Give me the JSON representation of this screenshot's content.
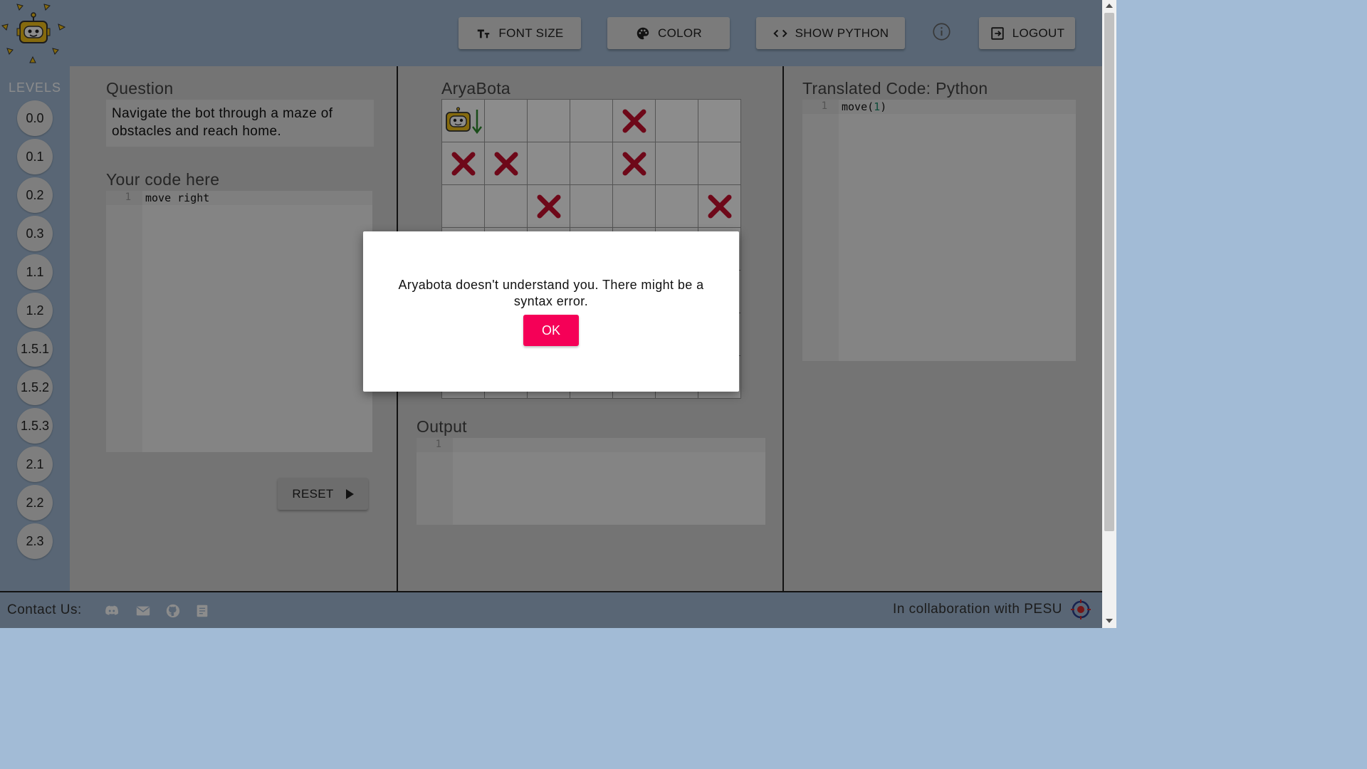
{
  "header": {
    "buttons": [
      {
        "id": "font-size",
        "label": "FONT SIZE",
        "icon": "font-size-icon"
      },
      {
        "id": "color",
        "label": "COLOR",
        "icon": "palette-icon"
      },
      {
        "id": "show-python",
        "label": "SHOW PYTHON",
        "icon": "code-icon"
      },
      {
        "id": "logout",
        "label": "LOGOUT",
        "icon": "logout-icon"
      }
    ],
    "info_icon": "info-icon"
  },
  "sidebar": {
    "title": "LEVELS",
    "levels": [
      "0.0",
      "0.1",
      "0.2",
      "0.3",
      "1.1",
      "1.2",
      "1.5.1",
      "1.5.2",
      "1.5.3",
      "2.1",
      "2.2",
      "2.3"
    ]
  },
  "question": {
    "title": "Question",
    "text": "Navigate the bot through a maze of obstacles and reach home."
  },
  "code_editor": {
    "title": "Your code here",
    "line_number": "1",
    "code": "move right"
  },
  "reset_button": {
    "label": "RESET"
  },
  "maze": {
    "title": "AryaBota",
    "rows": 7,
    "cols": 7,
    "bot": {
      "row": 0,
      "col": 0,
      "facing": "down"
    },
    "obstacles": [
      [
        0,
        4
      ],
      [
        1,
        0
      ],
      [
        1,
        1
      ],
      [
        1,
        4
      ],
      [
        2,
        2
      ],
      [
        2,
        6
      ]
    ],
    "colors": {
      "obstacle": "#c8102e",
      "arrow": "#2e8b2e"
    }
  },
  "output": {
    "title": "Output",
    "line_number": "1",
    "text": ""
  },
  "translated": {
    "title": "Translated Code: Python",
    "line_number": "1",
    "code_func": "move(",
    "code_arg": "1",
    "code_close": ")"
  },
  "footer": {
    "contact_label": "Contact Us:",
    "icons": [
      "discord-icon",
      "mail-icon",
      "github-icon",
      "docs-icon"
    ],
    "collab_text": "In collaboration with PESU"
  },
  "modal": {
    "message": "Aryabota doesn't understand you. There might be a syntax error.",
    "ok_label": "OK",
    "ok_color": "#f50057"
  }
}
